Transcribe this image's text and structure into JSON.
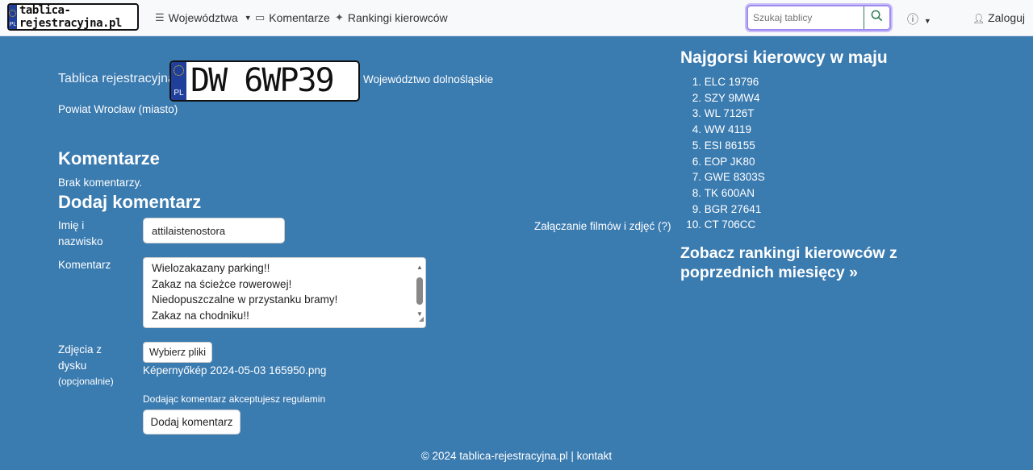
{
  "navbar": {
    "brand_text": "tablica-rejestracyjna.pl",
    "brand_country": "PL",
    "items": [
      {
        "label": "Województwa",
        "icon": "list-icon",
        "dropdown": true
      },
      {
        "label": "Komentarze",
        "icon": "comment-icon",
        "dropdown": false
      },
      {
        "label": "Rankingi kierowców",
        "icon": "sparkle-icon",
        "dropdown": false
      }
    ],
    "search_placeholder": "Szukaj tablicy",
    "help_icon": "question-circle-icon",
    "login_label": "Zaloguj"
  },
  "plate": {
    "label": "Tablica rejestracyjna",
    "number": "DW 6WP39",
    "country": "PL",
    "voivodeship": "Województwo dolnośląskie",
    "county": "Powiat Wrocław (miasto)"
  },
  "comments": {
    "heading": "Komentarze",
    "empty_text": "Brak komentarzy.",
    "add_heading": "Dodaj komentarz"
  },
  "form": {
    "name_label_line1": "Imię i",
    "name_label_line2": "nazwisko",
    "name_value": "attilaistenostora",
    "attach_label": "Załączanie filmów i zdjęć (?)",
    "comment_label": "Komentarz",
    "comment_lines": [
      "Wielozakazany parking!!",
      "Zakaz na ścieżce rowerowej!",
      "Niedopuszczalne w przystanku bramy!",
      "Zakaz na chodniku!!"
    ],
    "photos_label_line1": "Zdjęcia z",
    "photos_label_line2": "dysku",
    "photos_optional": "(opcjonalnie)",
    "choose_files_label": "Wybierz pliki",
    "chosen_file": "Képernyőkép 2024-05-03 165950.png",
    "terms_text": "Dodając komentarz akceptujesz regulamin",
    "submit_label": "Dodaj komentarz"
  },
  "sidebar": {
    "title": "Najgorsi kierowcy w maju",
    "ranking": [
      "ELC 19796",
      "SZY 9MW4",
      "WL 7126T",
      "WW 4119",
      "ESI 86155",
      "EOP JK80",
      "GWE 8303S",
      "TK 600AN",
      "BGR 27641",
      "CT 706CC"
    ],
    "numbers": [
      "1.",
      "2.",
      "3.",
      "4.",
      "5.",
      "6.",
      "7.",
      "8.",
      "9.",
      "10."
    ],
    "previous_link": "Zobacz rankingi kierowców z poprzednich miesięcy »"
  },
  "footer": {
    "text": "© 2024 tablica-rejestracyjna.pl | kontakt"
  },
  "colors": {
    "page_bg": "#3a7bb0",
    "navbar_bg": "#f8f9fa",
    "eu_blue": "#1f3f9a",
    "search_accent": "#2e7d57"
  }
}
